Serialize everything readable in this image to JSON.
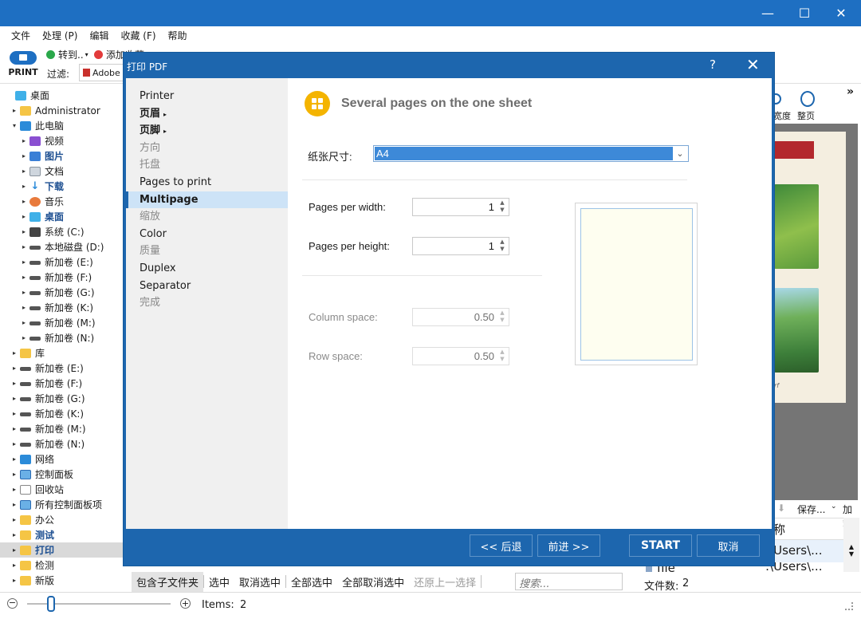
{
  "window": {
    "minimize": "—",
    "maximize": "☐",
    "close": "✕"
  },
  "menu": [
    "文件",
    "处理 (P)",
    "编辑",
    "收藏 (F)",
    "帮助"
  ],
  "toolbar": {
    "print_label": "PRINT",
    "goto_label": "转到..",
    "add_fav_label": "添加收藏",
    "filter_label": "过滤:",
    "filter_value": "Adobe A"
  },
  "tree": [
    {
      "label": "桌面",
      "icon": "i-desk",
      "indent": 0,
      "arrow": ""
    },
    {
      "label": "Administrator",
      "icon": "i-folder",
      "indent": 1,
      "arrow": "▸"
    },
    {
      "label": "此电脑",
      "icon": "i-pc",
      "indent": 1,
      "arrow": "▾"
    },
    {
      "label": "视频",
      "icon": "i-media",
      "indent": 2,
      "arrow": "▸"
    },
    {
      "label": "图片",
      "icon": "i-pic",
      "indent": 2,
      "arrow": "▸",
      "blue": true
    },
    {
      "label": "文档",
      "icon": "i-doc",
      "indent": 2,
      "arrow": "▸"
    },
    {
      "label": "下载",
      "icon": "i-down",
      "indent": 2,
      "arrow": "▸",
      "blue": true,
      "glyph": "↓"
    },
    {
      "label": "音乐",
      "icon": "i-music",
      "indent": 2,
      "arrow": "▸"
    },
    {
      "label": "桌面",
      "icon": "i-desk",
      "indent": 2,
      "arrow": "▸",
      "blue": true
    },
    {
      "label": "系统 (C:)",
      "icon": "i-sys",
      "indent": 2,
      "arrow": "▸"
    },
    {
      "label": "本地磁盘 (D:)",
      "icon": "i-drive",
      "indent": 2,
      "arrow": "▸"
    },
    {
      "label": "新加卷 (E:)",
      "icon": "i-drive",
      "indent": 2,
      "arrow": "▸"
    },
    {
      "label": "新加卷 (F:)",
      "icon": "i-drive",
      "indent": 2,
      "arrow": "▸"
    },
    {
      "label": "新加卷 (G:)",
      "icon": "i-drive",
      "indent": 2,
      "arrow": "▸"
    },
    {
      "label": "新加卷 (K:)",
      "icon": "i-drive",
      "indent": 2,
      "arrow": "▸"
    },
    {
      "label": "新加卷 (M:)",
      "icon": "i-drive",
      "indent": 2,
      "arrow": "▸"
    },
    {
      "label": "新加卷 (N:)",
      "icon": "i-drive",
      "indent": 2,
      "arrow": "▸"
    },
    {
      "label": "库",
      "icon": "i-folder",
      "indent": 1,
      "arrow": "▸"
    },
    {
      "label": "新加卷 (E:)",
      "icon": "i-drive",
      "indent": 1,
      "arrow": "▸"
    },
    {
      "label": "新加卷 (F:)",
      "icon": "i-drive",
      "indent": 1,
      "arrow": "▸"
    },
    {
      "label": "新加卷 (G:)",
      "icon": "i-drive",
      "indent": 1,
      "arrow": "▸"
    },
    {
      "label": "新加卷 (K:)",
      "icon": "i-drive",
      "indent": 1,
      "arrow": "▸"
    },
    {
      "label": "新加卷 (M:)",
      "icon": "i-drive",
      "indent": 1,
      "arrow": "▸"
    },
    {
      "label": "新加卷 (N:)",
      "icon": "i-drive",
      "indent": 1,
      "arrow": "▸"
    },
    {
      "label": "网络",
      "icon": "i-net",
      "indent": 1,
      "arrow": "▸"
    },
    {
      "label": "控制面板",
      "icon": "i-cp",
      "indent": 1,
      "arrow": "▸"
    },
    {
      "label": "回收站",
      "icon": "i-bin",
      "indent": 1,
      "arrow": "▸"
    },
    {
      "label": "所有控制面板项",
      "icon": "i-cp",
      "indent": 1,
      "arrow": "▸"
    },
    {
      "label": "办公",
      "icon": "i-folder",
      "indent": 1,
      "arrow": "▸"
    },
    {
      "label": "测试",
      "icon": "i-folder",
      "indent": 1,
      "arrow": "▸",
      "blue": true
    },
    {
      "label": "打印",
      "icon": "i-folder",
      "indent": 1,
      "arrow": "▸",
      "blue": true,
      "selected": true
    },
    {
      "label": "检测",
      "icon": "i-folder",
      "indent": 1,
      "arrow": "▸"
    },
    {
      "label": "新版",
      "icon": "i-folder",
      "indent": 1,
      "arrow": "▸"
    }
  ],
  "right_panel": {
    "more": "»",
    "width_btn": "宽度",
    "page_btn": "整页",
    "save_btn": "保存...",
    "add_btn": "加载",
    "col_name": "称",
    "path1": ":\\Users\\...",
    "path2": ":\\Users\\...",
    "row_file": "file",
    "file_count_label": "文件数:",
    "file_count": "2",
    "page_caption": "rf"
  },
  "bottom_bar": [
    "包含子文件夹",
    "选中",
    "取消选中",
    "全部选中",
    "全部取消选中",
    "还原上一选择"
  ],
  "search_placeholder": "搜索...",
  "status": {
    "items_label": "Items:",
    "items_count": "2"
  },
  "dialog": {
    "title": "打印 PDF",
    "help": "?",
    "close": "✕",
    "nav": [
      {
        "label": "Printer",
        "state": "normal"
      },
      {
        "label": "页眉",
        "state": "bold",
        "tri": true
      },
      {
        "label": "页脚",
        "state": "bold",
        "tri": true
      },
      {
        "label": "方向",
        "state": "disabled"
      },
      {
        "label": "托盘",
        "state": "disabled"
      },
      {
        "label": "Pages to print",
        "state": "normal"
      },
      {
        "label": "Multipage",
        "state": "active"
      },
      {
        "label": "缩放",
        "state": "disabled"
      },
      {
        "label": "Color",
        "state": "normal"
      },
      {
        "label": "质量",
        "state": "disabled"
      },
      {
        "label": "Duplex",
        "state": "normal"
      },
      {
        "label": "Separator",
        "state": "normal"
      },
      {
        "label": "完成",
        "state": "disabled"
      }
    ],
    "heading": "Several pages on the one sheet",
    "paper_size_label": "纸张尺寸:",
    "paper_size_value": "A4",
    "pages_per_width_label": "Pages per width:",
    "pages_per_width": "1",
    "pages_per_height_label": "Pages per height:",
    "pages_per_height": "1",
    "column_space_label": "Column space:",
    "column_space": "0.50",
    "row_space_label": "Row space:",
    "row_space": "0.50",
    "btn_back": "<< 后退",
    "btn_next": "前进 >>",
    "btn_start": "START",
    "btn_cancel": "取消"
  },
  "colors": {
    "title_bar": "#1e6fc2",
    "dialog_frame": "#1d66ae",
    "selection": "#3d89d8",
    "heading_icon": "#f4b400"
  }
}
